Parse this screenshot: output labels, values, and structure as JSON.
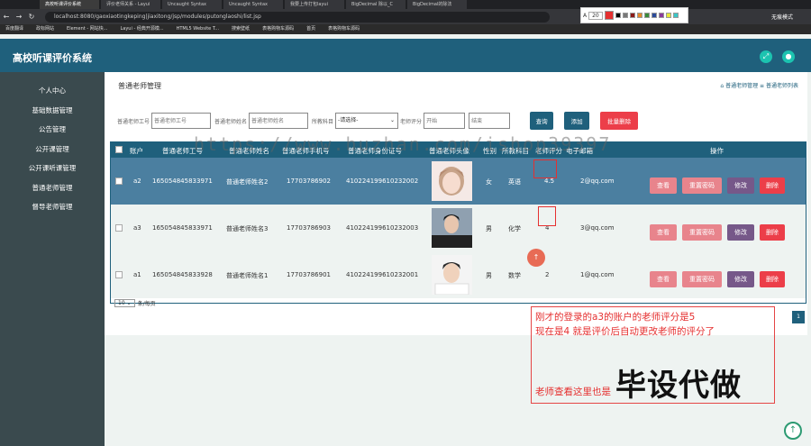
{
  "browser": {
    "tabs": [
      "高校听课评价系统",
      "评价老师关系 - Layui",
      "Uncaught Syntax",
      "Uncaught Syntax",
      "我要上传打包layui",
      "BigDecimal 除以_C",
      "BigDecimal的除法"
    ],
    "url": "localhost:8080/gaoxiaotingkeping|jiaxitong/jsp/modules/putonglaoshi/list.jsp",
    "profile": "无痕模式",
    "bookmarks": [
      "百度翻译",
      "政标网站",
      "Element - 网站快...",
      "Layui - 经典开源模...",
      "HTML5 Website T...",
      "搜索壁纸",
      "表格购物车源码",
      "首页",
      "表格购物车源码"
    ],
    "color_picker_size": "20"
  },
  "app": {
    "title": "高校听课评价系统",
    "accent": "#1f607c"
  },
  "sidebar": {
    "items": [
      "个人中心",
      "基础数据管理",
      "公告管理",
      "公开课管理",
      "公开课听课管理",
      "普通老师管理",
      "督导老师管理"
    ]
  },
  "page": {
    "title": "普通老师管理",
    "breadcrumb": [
      "普通老师管理",
      "普通老师列表"
    ]
  },
  "filter": {
    "job_no_label": "普通老师工号",
    "job_no_placeholder": "普通老师工号",
    "name_label": "普通老师姓名",
    "name_placeholder": "普通老师姓名",
    "subject_label": "所教科目",
    "subject_value": "-请选择-",
    "score_label": "老师评分",
    "start_placeholder": "开始",
    "end_placeholder": "结束",
    "query_btn": "查询",
    "add_btn": "添加",
    "batch_delete_btn": "批量删除"
  },
  "table": {
    "headers": [
      "账户",
      "普通老师工号",
      "普通老师姓名",
      "普通老师手机号",
      "普通老师身份证号",
      "普通老师头像",
      "性别",
      "所教科目",
      "老师评分",
      "电子邮箱",
      "操作"
    ],
    "rows": [
      {
        "account": "a2",
        "job_no": "1650548458339​71",
        "name": "普通老师姓名2",
        "phone": "17703786902",
        "id_card": "410224199610232002",
        "gender": "女",
        "subject": "英语",
        "score": "4.5",
        "email": "2@qq.com"
      },
      {
        "account": "a3",
        "job_no": "165054845833971",
        "name": "普通老师姓名3",
        "phone": "17703786903",
        "id_card": "410224199610232003",
        "gender": "男",
        "subject": "化学",
        "score": "4",
        "email": "3@qq.com"
      },
      {
        "account": "a1",
        "job_no": "165054845833928",
        "name": "普通老师姓名1",
        "phone": "17703786901",
        "id_card": "410224199610232001",
        "gender": "男",
        "subject": "数学",
        "score": "2",
        "email": "1@qq.com"
      }
    ],
    "actions": {
      "view": "查看",
      "reset": "重置密码",
      "edit": "修改",
      "delete": "删除"
    }
  },
  "pager": {
    "page_size": "10",
    "suffix": "条/每页",
    "current": "1"
  },
  "overlay": {
    "watermark": "https://www.huzhan.com/ishop39397",
    "note_line1": "刚才的登录的a3的账户的老师评分是5",
    "note_line2": "现在是4 就是评价后自动更改老师的评分了",
    "note_line3": "老师查看这里也是",
    "big_text": "毕设代做",
    "red_dot": "↑"
  }
}
